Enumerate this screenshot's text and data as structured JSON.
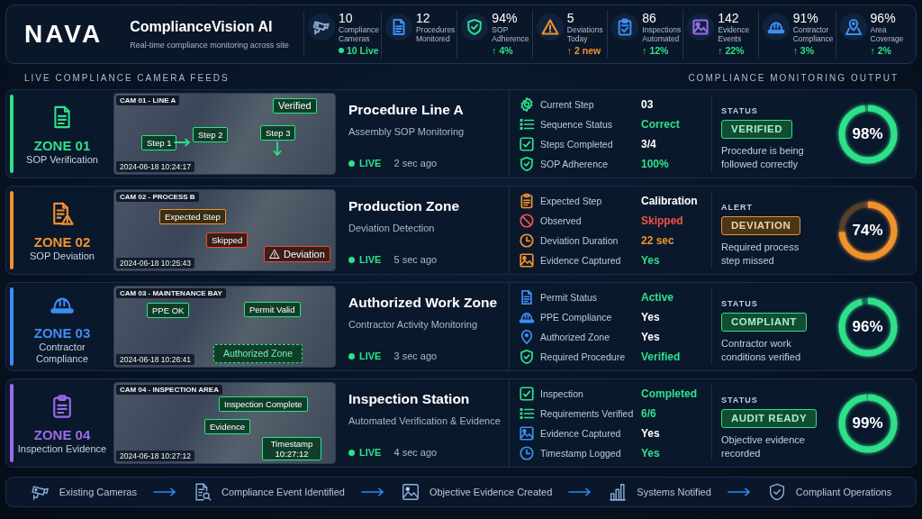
{
  "header": {
    "logo": "NAVA",
    "title": "ComplianceVision AI",
    "subtitle": "Real-time compliance monitoring across site"
  },
  "stats": [
    {
      "value": "10",
      "label": "Compliance Cameras",
      "trend": {
        "text": "10 Live",
        "kind": "live",
        "color": "#2ee08a"
      },
      "color": "#8fa8cc"
    },
    {
      "value": "12",
      "label": "Procedures Monitored",
      "color": "#3d8ef0"
    },
    {
      "value": "94%",
      "label": "SOP Adherence",
      "trend": {
        "text": "↑ 4%",
        "kind": "up",
        "color": "#2ee08a"
      },
      "color": "#2ee08a"
    },
    {
      "value": "5",
      "label": "Deviations Today",
      "trend": {
        "text": "↑ 2 new",
        "kind": "up",
        "color": "#f0922e"
      },
      "color": "#f0922e"
    },
    {
      "value": "86",
      "label": "Inspections Automated",
      "trend": {
        "text": "↑ 12%",
        "kind": "up",
        "color": "#2ee08a"
      },
      "color": "#3d8ef0"
    },
    {
      "value": "142",
      "label": "Evidence Events",
      "trend": {
        "text": "↑ 22%",
        "kind": "up",
        "color": "#2ee08a"
      },
      "color": "#9b6bea"
    },
    {
      "value": "91%",
      "label": "Contractor Compliance",
      "trend": {
        "text": "↑ 3%",
        "kind": "up",
        "color": "#2ee08a"
      },
      "color": "#3d8ef0"
    },
    {
      "value": "96%",
      "label": "Area Coverage",
      "trend": {
        "text": "↑ 2%",
        "kind": "up",
        "color": "#2ee08a"
      },
      "color": "#3d8ef0"
    }
  ],
  "sections": {
    "feeds": "LIVE COMPLIANCE CAMERA FEEDS",
    "output": "COMPLIANCE MONITORING OUTPUT"
  },
  "zones": [
    {
      "zone": "ZONE 01",
      "zone_label": "SOP Verification",
      "color": "#2ee08a",
      "camera": {
        "label": "CAM 01 - LINE A",
        "timestamp": "2024-06-18 10:24:17",
        "tags": [
          {
            "text": "Verified",
            "kind": "label",
            "color": "#2ee08a"
          },
          {
            "text": "Step 1",
            "kind": "label",
            "color": "#2ee08a"
          },
          {
            "text": "Step 2",
            "kind": "label",
            "color": "#2ee08a"
          },
          {
            "text": "Step 3",
            "kind": "label",
            "color": "#2ee08a"
          }
        ]
      },
      "title": "Procedure Line A",
      "subtitle": "Assembly SOP Monitoring",
      "live": "LIVE",
      "updated": "2 sec ago",
      "metrics": [
        {
          "label": "Current Step",
          "value": "03",
          "color": "#ffffff",
          "icon": {
            "color": "#2ee08a"
          }
        },
        {
          "label": "Sequence Status",
          "value": "Correct",
          "color": "#2ee08a",
          "icon": {
            "color": "#2ee08a"
          }
        },
        {
          "label": "Steps Completed",
          "value": "3/4",
          "color": "#ffffff",
          "icon": {
            "color": "#2ee08a"
          }
        },
        {
          "label": "SOP Adherence",
          "value": "100%",
          "color": "#2ee08a",
          "icon": {
            "color": "#2ee08a"
          }
        }
      ],
      "status": {
        "heading": "STATUS",
        "badge": "VERIFIED",
        "text": "Procedure is being followed correctly",
        "color": "#2ee08a"
      },
      "score": {
        "value": "98%",
        "level": 0.98,
        "color": "#2ee08a"
      }
    },
    {
      "zone": "ZONE 02",
      "zone_label": "SOP Deviation",
      "color": "#f0922e",
      "camera": {
        "label": "CAM 02 - PROCESS B",
        "timestamp": "2024-06-18 10:25:43",
        "tags": [
          {
            "text": "Expected Step",
            "kind": "label",
            "color": "#f0922e"
          },
          {
            "text": "Skipped",
            "kind": "label",
            "color": "#ef4a3c"
          },
          {
            "text": "Deviation",
            "kind": "alert",
            "color": "#ef4a3c"
          }
        ]
      },
      "title": "Production Zone",
      "subtitle": "Deviation Detection",
      "live": "LIVE",
      "updated": "5 sec ago",
      "metrics": [
        {
          "label": "Expected Step",
          "value": "Calibration",
          "color": "#ffffff",
          "icon": {
            "color": "#f0922e"
          }
        },
        {
          "label": "Observed",
          "value": "Skipped",
          "color": "#f0524a",
          "icon": {
            "color": "#f0524a"
          }
        },
        {
          "label": "Deviation Duration",
          "value": "22 sec",
          "color": "#f0922e",
          "icon": {
            "color": "#f0922e"
          }
        },
        {
          "label": "Evidence Captured",
          "value": "Yes",
          "color": "#2ee08a",
          "icon": {
            "color": "#f0922e"
          }
        }
      ],
      "status": {
        "heading": "ALERT",
        "badge": "DEVIATION",
        "text": "Required process step missed",
        "color": "#f0922e"
      },
      "score": {
        "value": "74%",
        "level": 0.74,
        "color": "#f0922e"
      }
    },
    {
      "zone": "ZONE 03",
      "zone_label": "Contractor Compliance",
      "color": "#3d8ef0",
      "camera": {
        "label": "CAM 03 - MAINTENANCE BAY",
        "timestamp": "2024-06-18 10:26:41",
        "tags": [
          {
            "text": "PPE OK",
            "kind": "label",
            "color": "#2ee08a"
          },
          {
            "text": "Permit Valid",
            "kind": "label",
            "color": "#2ee08a"
          },
          {
            "text": "Authorized Zone",
            "kind": "zone",
            "color": "#2ee08a"
          }
        ]
      },
      "title": "Authorized Work Zone",
      "subtitle": "Contractor Activity Monitoring",
      "live": "LIVE",
      "updated": "3 sec ago",
      "metrics": [
        {
          "label": "Permit Status",
          "value": "Active",
          "color": "#2ee08a",
          "icon": {
            "color": "#3d8ef0"
          }
        },
        {
          "label": "PPE Compliance",
          "value": "Yes",
          "color": "#ffffff",
          "icon": {
            "color": "#3d8ef0"
          }
        },
        {
          "label": "Authorized Zone",
          "value": "Yes",
          "color": "#ffffff",
          "icon": {
            "color": "#3d8ef0"
          }
        },
        {
          "label": "Required Procedure",
          "value": "Verified",
          "color": "#2ee08a",
          "icon": {
            "color": "#2ee08a"
          }
        }
      ],
      "status": {
        "heading": "STATUS",
        "badge": "COMPLIANT",
        "text": "Contractor work conditions verified",
        "color": "#2ee08a"
      },
      "score": {
        "value": "96%",
        "level": 0.96,
        "color": "#2ee08a"
      }
    },
    {
      "zone": "ZONE 04",
      "zone_label": "Inspection Evidence",
      "color": "#9b6bea",
      "camera": {
        "label": "CAM 04 - INSPECTION AREA",
        "timestamp": "2024-06-18 10:27:12",
        "tags": [
          {
            "text": "Inspection Complete",
            "kind": "label",
            "color": "#2ee08a"
          },
          {
            "text": "Evidence",
            "kind": "label",
            "color": "#2ee08a"
          },
          {
            "text": "Timestamp 10:27:12",
            "kind": "label",
            "color": "#2ee08a"
          }
        ]
      },
      "title": "Inspection Station",
      "subtitle": "Automated Verification & Evidence",
      "live": "LIVE",
      "updated": "4 sec ago",
      "metrics": [
        {
          "label": "Inspection",
          "value": "Completed",
          "color": "#2ee08a",
          "icon": {
            "color": "#2ee08a"
          }
        },
        {
          "label": "Requirements Verified",
          "value": "6/6",
          "color": "#2ee08a",
          "icon": {
            "color": "#2ee08a"
          }
        },
        {
          "label": "Evidence Captured",
          "value": "Yes",
          "color": "#ffffff",
          "icon": {
            "color": "#3d8ef0"
          }
        },
        {
          "label": "Timestamp Logged",
          "value": "Yes",
          "color": "#2ee08a",
          "icon": {
            "color": "#3d8ef0"
          }
        }
      ],
      "status": {
        "heading": "STATUS",
        "badge": "AUDIT READY",
        "text": "Objective evidence recorded",
        "color": "#2ee08a"
      },
      "score": {
        "value": "99%",
        "level": 0.99,
        "color": "#2ee08a"
      }
    }
  ],
  "flow": [
    "Existing Cameras",
    "Compliance Event Identified",
    "Objective Evidence Created",
    "Systems Notified",
    "Compliant Operations"
  ]
}
